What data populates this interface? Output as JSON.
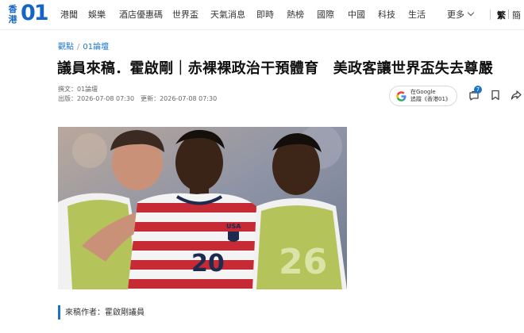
{
  "brand": {
    "logo_cn": "香港",
    "logo_num": "01",
    "accent": "#1565c8"
  },
  "nav": {
    "items": [
      "港聞",
      "娛樂",
      "酒店優惠碼",
      "世界盃",
      "天氣消息",
      "即時",
      "熱榜",
      "國際",
      "中國",
      "科技",
      "生活"
    ],
    "more_label": "更多",
    "lang_traditional": "繁",
    "lang_simplified": "簡"
  },
  "breadcrumb": {
    "section": "觀點",
    "separator": "/",
    "subsection": "01論壇"
  },
  "article": {
    "title": "議員來稿．霍啟剛｜赤裸裸政治干預體育　美政客讓世界盃失去尊嚴",
    "author_label": "撰文：01論壇",
    "published": "出版：2026-07-08 07:30",
    "updated": "更新：2026-07-08 07:30",
    "byline": "來稿作者：霍啟剛議員"
  },
  "follow_button": {
    "line1": "在Google",
    "line2": "追蹤《香港01》"
  },
  "actions": {
    "comment_count": "7",
    "icons": [
      "comment-icon",
      "bookmark-icon",
      "share-icon"
    ]
  },
  "hero_image": {
    "jersey_number": "20",
    "jersey_crest": "USA",
    "trophy_mark": "26"
  }
}
